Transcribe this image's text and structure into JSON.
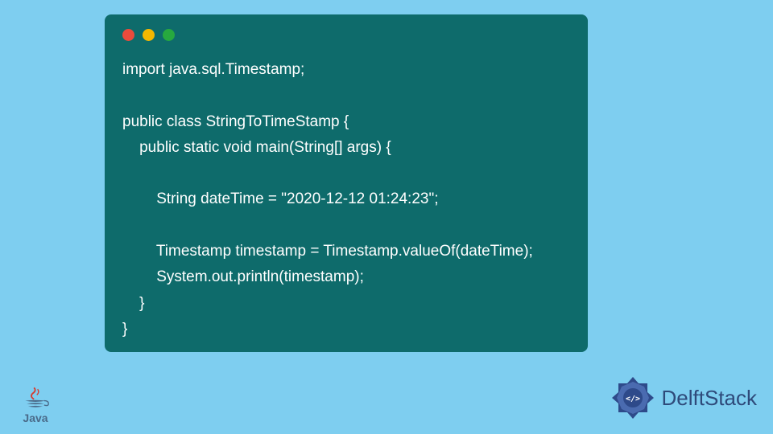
{
  "code": {
    "lines": [
      "import java.sql.Timestamp;",
      "",
      "public class StringToTimeStamp {",
      "    public static void main(String[] args) {",
      "",
      "        String dateTime = \"2020-12-12 01:24:23\";",
      "",
      "        Timestamp timestamp = Timestamp.valueOf(dateTime);",
      "        System.out.println(timestamp);",
      "    }",
      "}"
    ]
  },
  "logos": {
    "java_label": "Java",
    "delft_label": "DelftStack"
  }
}
